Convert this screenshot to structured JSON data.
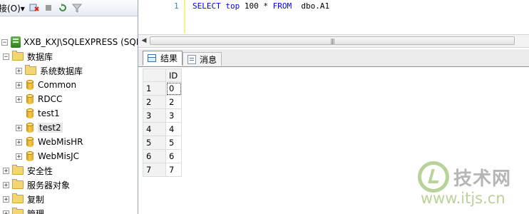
{
  "toolbar": {
    "connect_label": "接(O)▾"
  },
  "tree": {
    "server": "XXB_KXJ\\SQLEXPRESS (SQL S",
    "databases": "数据库",
    "system_databases": "系统数据库",
    "db_items": [
      "Common",
      "RDCC",
      "test1",
      "test2",
      "WebMisHR",
      "WebMisJC"
    ],
    "security": "安全性",
    "server_objects": "服务器对象",
    "replication": "复制",
    "management": "管理"
  },
  "editor": {
    "line_number": "1",
    "sql": {
      "select": "SELECT",
      "top": "top",
      "count": "100",
      "star": "*",
      "from": "FROM",
      "table": "dbo.A1"
    }
  },
  "tabs": {
    "results": "结果",
    "messages": "消息"
  },
  "results": {
    "column": "ID",
    "rows": [
      {
        "num": "1",
        "id": "0"
      },
      {
        "num": "2",
        "id": "2"
      },
      {
        "num": "3",
        "id": "3"
      },
      {
        "num": "4",
        "id": "4"
      },
      {
        "num": "5",
        "id": "5"
      },
      {
        "num": "6",
        "id": "6"
      },
      {
        "num": "7",
        "id": "7"
      }
    ]
  },
  "watermark": {
    "title": "技术网",
    "url": "www.itjs.cn"
  }
}
